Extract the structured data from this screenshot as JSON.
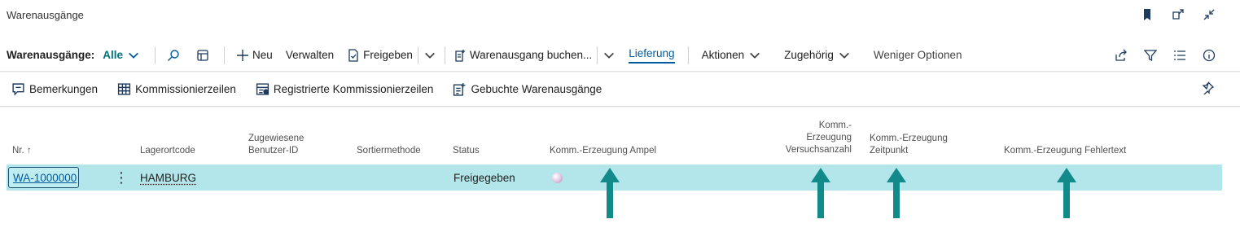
{
  "window": {
    "title": "Warenausgänge",
    "top_icons": [
      "bookmark-icon",
      "open-new-window-icon",
      "collapse-icon"
    ]
  },
  "commandbar": {
    "view_label": "Warenausgänge:",
    "filter_value": "Alle",
    "new_label": "Neu",
    "manage_label": "Verwalten",
    "release_label": "Freigeben",
    "post_label": "Warenausgang buchen...",
    "delivery_label": "Lieferung",
    "actions_label": "Aktionen",
    "related_label": "Zugehörig",
    "fewer_options_label": "Weniger Optionen"
  },
  "subbar": {
    "items": [
      {
        "label": "Bemerkungen",
        "icon": "comment-icon"
      },
      {
        "label": "Kommissionierzeilen",
        "icon": "lines-icon"
      },
      {
        "label": "Registrierte Kommissionierzeilen",
        "icon": "registered-lines-icon"
      },
      {
        "label": "Gebuchte Warenausgänge",
        "icon": "posted-shipments-icon"
      }
    ]
  },
  "table": {
    "headers": {
      "nr": "Nr.",
      "sort_arrow": "↑",
      "location": "Lagerortcode",
      "user_line1": "Zugewiesene",
      "user_line2": "Benutzer-ID",
      "sort_method": "Sortiermethode",
      "status": "Status",
      "ampel": "Komm.-Erzeugung Ampel",
      "attempts_line1": "Komm.-",
      "attempts_line2": "Erzeugung",
      "attempts_line3": "Versuchsanzahl",
      "time_line1": "Komm.-Erzeugung",
      "time_line2": "Zeitpunkt",
      "error_text": "Komm.-Erzeugung Fehlertext"
    },
    "rows": [
      {
        "nr": "WA-1000000",
        "location": "HAMBURG",
        "user": "",
        "sort_method": "",
        "status": "Freigegeben",
        "ampel_color": "#d9bfe0"
      }
    ]
  },
  "colors": {
    "accent": "#005a9e",
    "row_selected": "#b2e6ea",
    "arrow": "#138a8a"
  }
}
